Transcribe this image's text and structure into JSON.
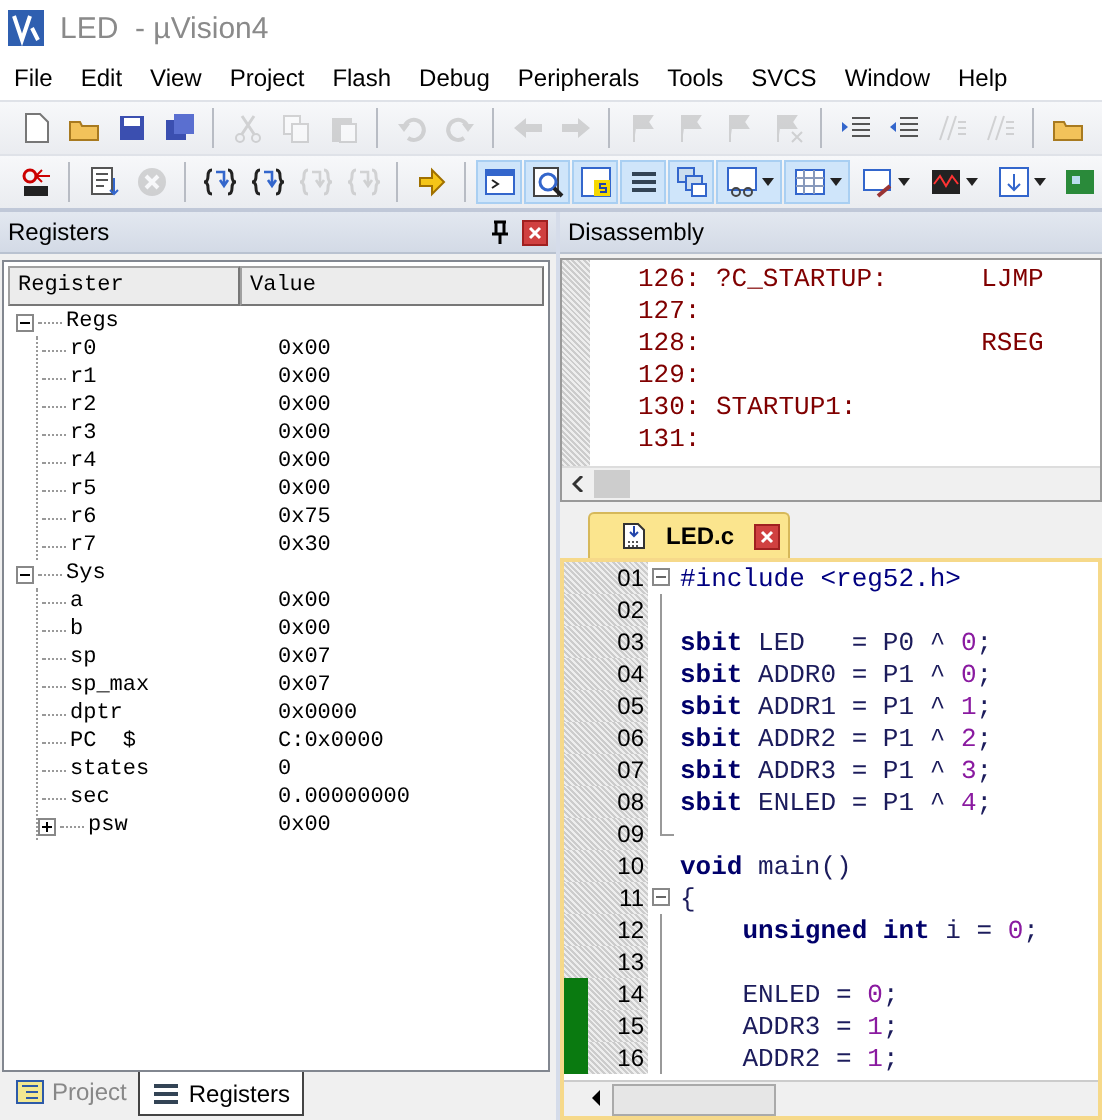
{
  "window": {
    "title": "LED  - µVision4"
  },
  "menu": [
    "File",
    "Edit",
    "View",
    "Project",
    "Flash",
    "Debug",
    "Peripherals",
    "Tools",
    "SVCS",
    "Window",
    "Help"
  ],
  "toolbar_file": [
    {
      "kind": "new",
      "disabled": false
    },
    {
      "kind": "open",
      "disabled": false
    },
    {
      "kind": "save",
      "disabled": false
    },
    {
      "kind": "saveall",
      "disabled": false
    },
    {
      "kind": "separator"
    },
    {
      "kind": "cut",
      "disabled": true
    },
    {
      "kind": "copy",
      "disabled": true
    },
    {
      "kind": "paste",
      "disabled": true
    },
    {
      "kind": "separator"
    },
    {
      "kind": "undo",
      "disabled": true
    },
    {
      "kind": "redo",
      "disabled": true
    },
    {
      "kind": "separator"
    },
    {
      "kind": "back",
      "disabled": true
    },
    {
      "kind": "forward",
      "disabled": true
    },
    {
      "kind": "separator"
    },
    {
      "kind": "flag",
      "disabled": true
    },
    {
      "kind": "flagprev",
      "disabled": true
    },
    {
      "kind": "flagnext",
      "disabled": true
    },
    {
      "kind": "flagclear",
      "disabled": true
    },
    {
      "kind": "separator"
    },
    {
      "kind": "indent",
      "disabled": false
    },
    {
      "kind": "unindent",
      "disabled": false
    },
    {
      "kind": "comment",
      "disabled": true
    },
    {
      "kind": "uncomment",
      "disabled": true
    },
    {
      "kind": "separator"
    },
    {
      "kind": "folder",
      "disabled": false
    }
  ],
  "toolbar_debug": [
    {
      "kind": "reset",
      "disabled": false,
      "on": false,
      "menu": false
    },
    {
      "kind": "separator"
    },
    {
      "kind": "run",
      "disabled": false,
      "on": false,
      "menu": false
    },
    {
      "kind": "stop",
      "disabled": true,
      "on": false,
      "menu": false
    },
    {
      "kind": "separator"
    },
    {
      "kind": "stepinto",
      "disabled": false,
      "on": false,
      "menu": false
    },
    {
      "kind": "stepover",
      "disabled": false,
      "on": false,
      "menu": false
    },
    {
      "kind": "stepout",
      "disabled": true,
      "on": false,
      "menu": false
    },
    {
      "kind": "runcursor",
      "disabled": true,
      "on": false,
      "menu": false
    },
    {
      "kind": "separator"
    },
    {
      "kind": "nextstatement",
      "disabled": false,
      "on": false,
      "menu": false
    },
    {
      "kind": "separator"
    },
    {
      "kind": "command",
      "disabled": false,
      "on": true,
      "menu": false
    },
    {
      "kind": "disassembly",
      "disabled": false,
      "on": true,
      "menu": false
    },
    {
      "kind": "symbols",
      "disabled": false,
      "on": true,
      "menu": false
    },
    {
      "kind": "registers",
      "disabled": false,
      "on": true,
      "menu": false
    },
    {
      "kind": "callstack",
      "disabled": false,
      "on": true,
      "menu": false
    },
    {
      "kind": "watch",
      "disabled": false,
      "on": true,
      "menu": true
    },
    {
      "kind": "memory",
      "disabled": false,
      "on": true,
      "menu": true
    },
    {
      "kind": "serial",
      "disabled": false,
      "on": false,
      "menu": true
    },
    {
      "kind": "analyzer",
      "disabled": false,
      "on": false,
      "menu": true
    },
    {
      "kind": "trace",
      "disabled": false,
      "on": false,
      "menu": true
    },
    {
      "kind": "toolbox",
      "disabled": false,
      "on": false,
      "menu": false
    }
  ],
  "registers_panel": {
    "title": "Registers",
    "columns": [
      "Register",
      "Value"
    ],
    "tree": [
      {
        "name": "Regs",
        "expanded": true,
        "children": [
          {
            "name": "r0",
            "value": "0x00"
          },
          {
            "name": "r1",
            "value": "0x00"
          },
          {
            "name": "r2",
            "value": "0x00"
          },
          {
            "name": "r3",
            "value": "0x00"
          },
          {
            "name": "r4",
            "value": "0x00"
          },
          {
            "name": "r5",
            "value": "0x00"
          },
          {
            "name": "r6",
            "value": "0x75"
          },
          {
            "name": "r7",
            "value": "0x30"
          }
        ]
      },
      {
        "name": "Sys",
        "expanded": true,
        "children": [
          {
            "name": "a",
            "value": "0x00"
          },
          {
            "name": "b",
            "value": "0x00"
          },
          {
            "name": "sp",
            "value": "0x07"
          },
          {
            "name": "sp_max",
            "value": "0x07"
          },
          {
            "name": "dptr",
            "value": "0x0000"
          },
          {
            "name": "PC  $",
            "value": "C:0x0000"
          },
          {
            "name": "states",
            "value": "0"
          },
          {
            "name": "sec",
            "value": "0.00000000"
          },
          {
            "name": "psw",
            "value": "0x00",
            "expanded": false
          }
        ]
      }
    ],
    "tabs": [
      {
        "label": "Project",
        "selected": false
      },
      {
        "label": "Registers",
        "selected": true
      }
    ]
  },
  "disassembly": {
    "title": "Disassembly",
    "lines": [
      "126: ?C_STARTUP:      LJMP",
      "127:",
      "128:                  RSEG",
      "129:",
      "130: STARTUP1:",
      "131:"
    ]
  },
  "editor": {
    "tabs": [
      {
        "label": "LED.c",
        "selected": true
      }
    ],
    "lines": [
      {
        "num": "01",
        "fold_toggle": true,
        "covered": false,
        "code": [
          {
            "kind": "pre",
            "text": "#include <reg52.h>"
          }
        ]
      },
      {
        "num": "02",
        "covered": false
      },
      {
        "num": "03",
        "covered": false,
        "code": [
          {
            "kind": "kw",
            "text": "sbit"
          },
          {
            "kind": "text",
            "text": " LED   = P0 ^ "
          },
          {
            "kind": "num",
            "text": "0"
          },
          {
            "kind": "text",
            "text": ";"
          }
        ]
      },
      {
        "num": "04",
        "covered": false,
        "code": [
          {
            "kind": "kw",
            "text": "sbit"
          },
          {
            "kind": "text",
            "text": " ADDR0 = P1 ^ "
          },
          {
            "kind": "num",
            "text": "0"
          },
          {
            "kind": "text",
            "text": ";"
          }
        ]
      },
      {
        "num": "05",
        "covered": false,
        "code": [
          {
            "kind": "kw",
            "text": "sbit"
          },
          {
            "kind": "text",
            "text": " ADDR1 = P1 ^ "
          },
          {
            "kind": "num",
            "text": "1"
          },
          {
            "kind": "text",
            "text": ";"
          }
        ]
      },
      {
        "num": "06",
        "covered": false,
        "code": [
          {
            "kind": "kw",
            "text": "sbit"
          },
          {
            "kind": "text",
            "text": " ADDR2 = P1 ^ "
          },
          {
            "kind": "num",
            "text": "2"
          },
          {
            "kind": "text",
            "text": ";"
          }
        ]
      },
      {
        "num": "07",
        "covered": false,
        "code": [
          {
            "kind": "kw",
            "text": "sbit"
          },
          {
            "kind": "text",
            "text": " ADDR3 = P1 ^ "
          },
          {
            "kind": "num",
            "text": "3"
          },
          {
            "kind": "text",
            "text": ";"
          }
        ]
      },
      {
        "num": "08",
        "covered": false,
        "code": [
          {
            "kind": "kw",
            "text": "sbit"
          },
          {
            "kind": "text",
            "text": " ENLED = P1 ^ "
          },
          {
            "kind": "num",
            "text": "4"
          },
          {
            "kind": "text",
            "text": ";"
          }
        ]
      },
      {
        "num": "09",
        "covered": false
      },
      {
        "num": "10",
        "covered": false,
        "code": [
          {
            "kind": "kw",
            "text": "void"
          },
          {
            "kind": "text",
            "text": " main()"
          }
        ]
      },
      {
        "num": "11",
        "fold_toggle": true,
        "covered": false,
        "code": [
          {
            "kind": "text",
            "text": "{"
          }
        ]
      },
      {
        "num": "12",
        "covered": false,
        "code": [
          {
            "kind": "kw",
            "text": "    unsigned int"
          },
          {
            "kind": "text",
            "text": " i = "
          },
          {
            "kind": "num",
            "text": "0"
          },
          {
            "kind": "text",
            "text": ";"
          }
        ]
      },
      {
        "num": "13",
        "covered": false
      },
      {
        "num": "14",
        "covered": true,
        "code": [
          {
            "kind": "text",
            "text": "    ENLED = "
          },
          {
            "kind": "num",
            "text": "0"
          },
          {
            "kind": "text",
            "text": ";"
          }
        ]
      },
      {
        "num": "15",
        "covered": true,
        "code": [
          {
            "kind": "text",
            "text": "    ADDR3 = "
          },
          {
            "kind": "num",
            "text": "1"
          },
          {
            "kind": "text",
            "text": ";"
          }
        ]
      },
      {
        "num": "16",
        "covered": true,
        "code": [
          {
            "kind": "text",
            "text": "    ADDR2 = "
          },
          {
            "kind": "num",
            "text": "1"
          },
          {
            "kind": "text",
            "text": ";"
          }
        ]
      }
    ]
  }
}
